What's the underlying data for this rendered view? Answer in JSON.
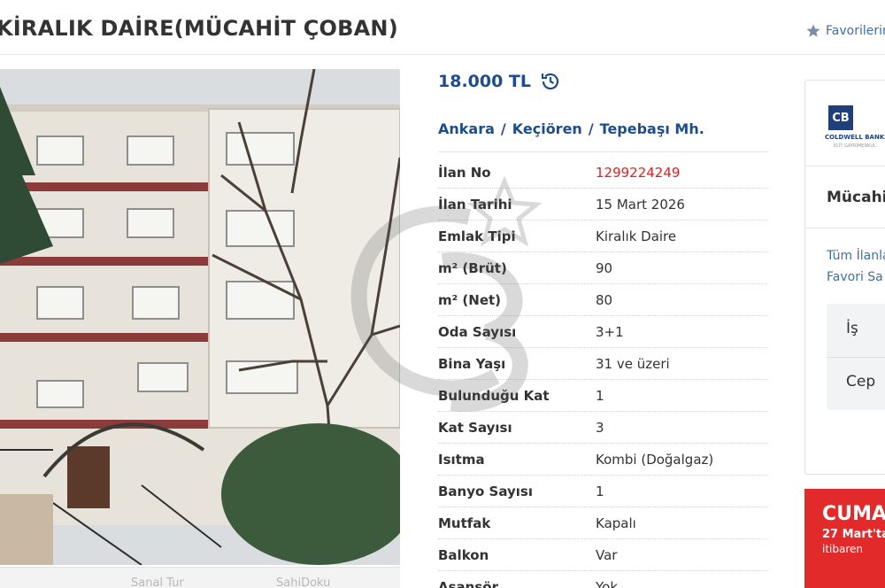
{
  "header": {
    "title": "KİRALIK DAİRE(MÜCAHİT ÇOBAN)",
    "favorites_label": "Favorilerim"
  },
  "listing": {
    "price": "18.000 TL",
    "breadcrumb": [
      "Ankara",
      "Keçiören",
      "Tepebaşı Mh."
    ],
    "attributes": [
      {
        "key": "İlan No",
        "value": "1299224249"
      },
      {
        "key": "İlan Tarihi",
        "value": "15 Mart 2026"
      },
      {
        "key": "Emlak Tipi",
        "value": "Kiralık Daire"
      },
      {
        "key": "m² (Brüt)",
        "value": "90"
      },
      {
        "key": "m² (Net)",
        "value": "80"
      },
      {
        "key": "Oda Sayısı",
        "value": "3+1"
      },
      {
        "key": "Bina Yaşı",
        "value": "31 ve üzeri"
      },
      {
        "key": "Bulunduğu Kat",
        "value": "1"
      },
      {
        "key": "Kat Sayısı",
        "value": "3"
      },
      {
        "key": "Isıtma",
        "value": "Kombi (Doğalgaz)"
      },
      {
        "key": "Banyo Sayısı",
        "value": "1"
      },
      {
        "key": "Mutfak",
        "value": "Kapalı"
      },
      {
        "key": "Balkon",
        "value": "Var"
      },
      {
        "key": "Asansör",
        "value": "Yok"
      }
    ]
  },
  "photo_bar": {
    "sanal_tur": "Sanal Tur",
    "sahidoku": "SahiDoku"
  },
  "store": {
    "logo_mark": "CB",
    "brand": "COLDWELL BANKER",
    "brand_sub": "ELİT GAYRİMENKUL",
    "name": "Mücahit",
    "all_listings": "Tüm İlanla",
    "favorite_seller": "Favori Sa",
    "phone_work": "İş",
    "phone_mobile": "Cep"
  },
  "promo": {
    "big": "CUMA",
    "mid": "27 Mart'ta",
    "small": "itibaren"
  },
  "colors": {
    "link_blue": "#1e4c8c",
    "listing_no_red": "#e0201e",
    "promo_red": "#e32a2a",
    "logo_navy": "#1e3f7a"
  }
}
